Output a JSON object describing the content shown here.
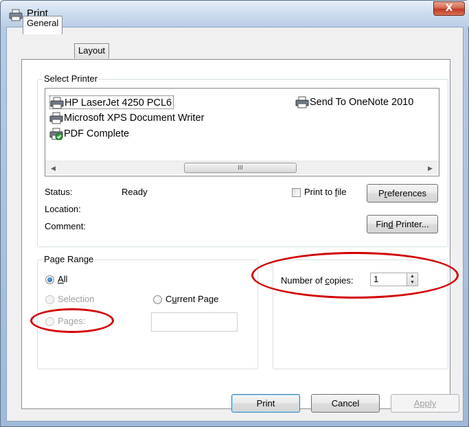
{
  "window": {
    "title": "Print",
    "close_glyph": "X"
  },
  "tabs": [
    {
      "label": "General"
    },
    {
      "label": "Layout"
    }
  ],
  "select_printer": {
    "group_label": "Select Printer",
    "printers": [
      {
        "name": "HP LaserJet 4250 PCL6",
        "icon": "printer-icon",
        "selected": true
      },
      {
        "name": "Send To OneNote 2010",
        "icon": "printer-icon"
      },
      {
        "name": "Microsoft XPS Document Writer",
        "icon": "printer-icon"
      },
      {
        "name": "PDF Complete",
        "icon": "printer-default-check-icon"
      }
    ],
    "scroll_thumb_glyph": "III",
    "status_label": "Status:",
    "status_value": "Ready",
    "location_label": "Location:",
    "comment_label": "Comment:",
    "print_to_file_pre": "Print to ",
    "print_to_file_key": "f",
    "print_to_file_post": "ile",
    "preferences_pre": "P",
    "preferences_key": "r",
    "preferences_post": "eferences",
    "find_printer_pre": "Fin",
    "find_printer_key": "d",
    "find_printer_post": " Printer..."
  },
  "page_range": {
    "group_label": "Page Range",
    "all_pre": "",
    "all_key": "A",
    "all_post": "ll",
    "selection_label": "Selection",
    "current_page_pre": "C",
    "current_page_key": "u",
    "current_page_post": "rrent Page",
    "pages_pre": "Pa",
    "pages_key": "g",
    "pages_post": "es:",
    "pages_value": ""
  },
  "copies": {
    "label_pre": "Number of ",
    "label_key": "c",
    "label_post": "opies:",
    "value": "1"
  },
  "footer": {
    "print_label": "Print",
    "cancel_label": "Cancel",
    "apply_label": "Apply"
  },
  "annotation_color": "#d40000"
}
